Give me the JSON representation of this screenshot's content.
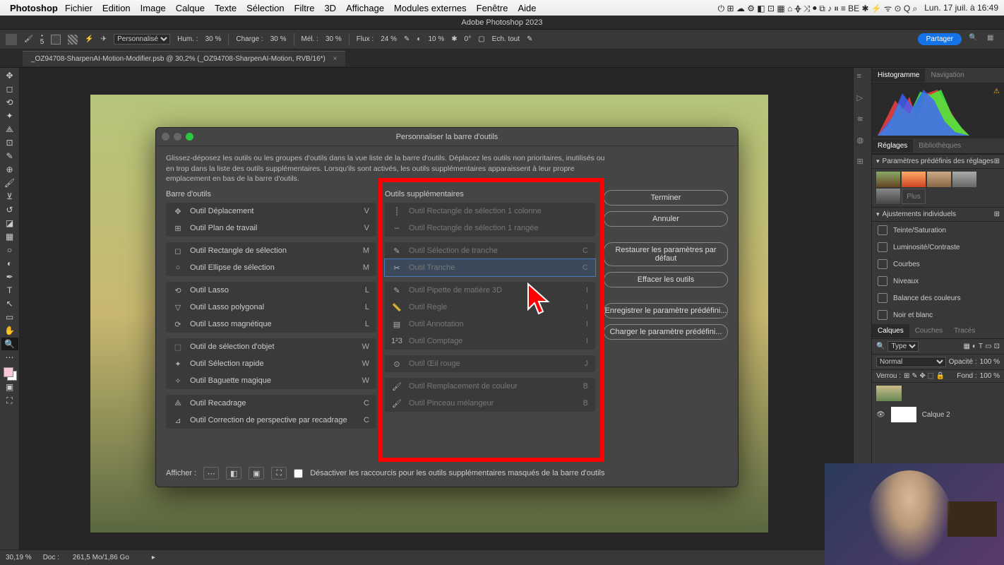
{
  "menubar": {
    "app": "Photoshop",
    "items": [
      "Fichier",
      "Edition",
      "Image",
      "Calque",
      "Texte",
      "Sélection",
      "Filtre",
      "3D",
      "Affichage",
      "Modules externes",
      "Fenêtre",
      "Aide"
    ],
    "datetime": "Lun. 17 juil. à 16:49"
  },
  "app_title": "Adobe Photoshop 2023",
  "options": {
    "preset": "Personnalisé",
    "hum_label": "Hum. :",
    "hum": "30 %",
    "charge_label": "Charge :",
    "charge": "30 %",
    "mel_label": "Mél. :",
    "mel": "30 %",
    "flux_label": "Flux :",
    "flux": "24 %",
    "opacity": "10 %",
    "angle": "0°",
    "ech_tout": "Ech. tout",
    "share": "Partager",
    "brush_size": "5"
  },
  "tab": "_OZ94708-SharpenAI-Motion-Modifier.psb @ 30,2% (_OZ94708-SharpenAI-Motion, RVB/16*)",
  "dialog": {
    "title": "Personnaliser la barre d'outils",
    "description": "Glissez-déposez les outils ou les groupes d'outils dans la vue liste de la barre d'outils. Déplacez les outils non prioritaires, inutilisés ou en trop dans la liste des outils supplémentaires. Lorsqu'ils sont activés, les outils supplémentaires apparaissent à leur propre emplacement en bas de la barre d'outils.",
    "col_left_title": "Barre d'outils",
    "col_mid_title": "Outils supplémentaires",
    "left_groups": [
      [
        {
          "label": "Outil Déplacement",
          "key": "V"
        },
        {
          "label": "Outil Plan de travail",
          "key": "V"
        }
      ],
      [
        {
          "label": "Outil Rectangle de sélection",
          "key": "M"
        },
        {
          "label": "Outil Ellipse de sélection",
          "key": "M"
        }
      ],
      [
        {
          "label": "Outil Lasso",
          "key": "L"
        },
        {
          "label": "Outil Lasso polygonal",
          "key": "L"
        },
        {
          "label": "Outil Lasso magnétique",
          "key": "L"
        }
      ],
      [
        {
          "label": "Outil de sélection d'objet",
          "key": "W"
        },
        {
          "label": "Outil Sélection rapide",
          "key": "W"
        },
        {
          "label": "Outil Baguette magique",
          "key": "W"
        }
      ],
      [
        {
          "label": "Outil Recadrage",
          "key": "C"
        },
        {
          "label": "Outil Correction de perspective par recadrage",
          "key": "C"
        }
      ]
    ],
    "mid_groups": [
      [
        {
          "label": "Outil Rectangle de sélection 1 colonne",
          "key": ""
        },
        {
          "label": "Outil Rectangle de sélection 1 rangée",
          "key": ""
        }
      ],
      [
        {
          "label": "Outil Sélection de tranche",
          "key": "C"
        },
        {
          "label": "Outil Tranche",
          "key": "C",
          "selected": true
        }
      ],
      [
        {
          "label": "Outil Pipette de matière 3D",
          "key": "I"
        },
        {
          "label": "Outil Règle",
          "key": "I"
        },
        {
          "label": "Outil Annotation",
          "key": "I"
        },
        {
          "label": "Outil Comptage",
          "key": "I"
        }
      ],
      [
        {
          "label": "Outil Œil rouge",
          "key": "J"
        }
      ],
      [
        {
          "label": "Outil Remplacement de couleur",
          "key": "B"
        },
        {
          "label": "Outil Pinceau mélangeur",
          "key": "B"
        }
      ]
    ],
    "buttons": {
      "done": "Terminer",
      "cancel": "Annuler",
      "restore": "Restaurer les paramètres par défaut",
      "clear": "Effacer les outils",
      "save_preset": "Enregistrer le paramètre prédéfini...",
      "load_preset": "Charger le paramètre prédéfini..."
    },
    "footer": {
      "show_label": "Afficher :",
      "disable_label": "Désactiver les raccourcis pour les outils supplémentaires masqués de la barre d'outils"
    }
  },
  "panels": {
    "histogram_tab": "Histogramme",
    "navigation_tab": "Navigation",
    "reglages_tab": "Réglages",
    "biblio_tab": "Bibliothèques",
    "presets_header": "Paramètres prédéfinis des réglages",
    "plus": "Plus",
    "adjust_header": "Ajustements individuels",
    "adjustments": [
      "Teinte/Saturation",
      "Luminosité/Contraste",
      "Courbes",
      "Niveaux",
      "Balance des couleurs",
      "Noir et blanc"
    ],
    "layers_tab": "Calques",
    "couches_tab": "Couches",
    "traces_tab": "Tracés",
    "type_filter": "Type",
    "blend": "Normal",
    "opacity_label": "Opacité :",
    "opacity": "100 %",
    "verrou_label": "Verrou :",
    "fond_label": "Fond :",
    "fond": "100 %",
    "layer_name": "Calque 2"
  },
  "status": {
    "zoom": "30,19 %",
    "doc_label": "Doc :",
    "doc": "261,5 Mo/1,86 Go"
  }
}
